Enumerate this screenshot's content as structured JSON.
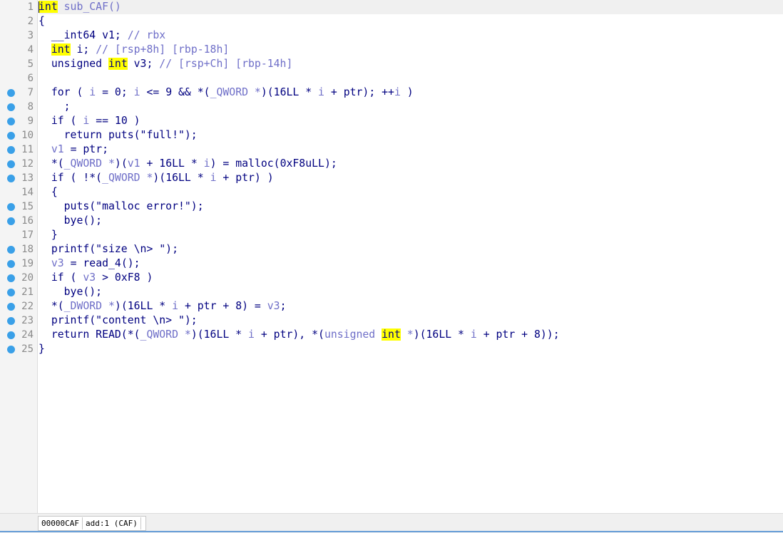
{
  "code_lines": [
    {
      "num": "1",
      "bp": false,
      "tokens": [
        {
          "t": "int",
          "c": "hl"
        },
        {
          "t": " sub_CAF()",
          "c": "var"
        }
      ]
    },
    {
      "num": "2",
      "bp": false,
      "tokens": [
        {
          "t": "{",
          "c": "plain"
        }
      ]
    },
    {
      "num": "3",
      "bp": false,
      "tokens": [
        {
          "t": "  __int64 v1; ",
          "c": "plain"
        },
        {
          "t": "// rbx",
          "c": "comment"
        }
      ]
    },
    {
      "num": "4",
      "bp": false,
      "tokens": [
        {
          "t": "  ",
          "c": "plain"
        },
        {
          "t": "int",
          "c": "hl"
        },
        {
          "t": " i; ",
          "c": "plain"
        },
        {
          "t": "// [rsp+8h] [rbp-18h]",
          "c": "comment"
        }
      ]
    },
    {
      "num": "5",
      "bp": false,
      "tokens": [
        {
          "t": "  unsigned ",
          "c": "plain"
        },
        {
          "t": "int",
          "c": "hl"
        },
        {
          "t": " v3; ",
          "c": "plain"
        },
        {
          "t": "// [rsp+Ch] [rbp-14h]",
          "c": "comment"
        }
      ]
    },
    {
      "num": "6",
      "bp": false,
      "tokens": []
    },
    {
      "num": "7",
      "bp": true,
      "tokens": [
        {
          "t": "  for ( ",
          "c": "plain"
        },
        {
          "t": "i",
          "c": "var"
        },
        {
          "t": " = 0; ",
          "c": "plain"
        },
        {
          "t": "i",
          "c": "var"
        },
        {
          "t": " <= 9 && *(",
          "c": "plain"
        },
        {
          "t": "_QWORD *",
          "c": "var"
        },
        {
          "t": ")(16LL * ",
          "c": "plain"
        },
        {
          "t": "i",
          "c": "var"
        },
        {
          "t": " + ptr); ++",
          "c": "plain"
        },
        {
          "t": "i",
          "c": "var"
        },
        {
          "t": " )",
          "c": "plain"
        }
      ]
    },
    {
      "num": "8",
      "bp": true,
      "tokens": [
        {
          "t": "    ;",
          "c": "plain"
        }
      ]
    },
    {
      "num": "9",
      "bp": true,
      "tokens": [
        {
          "t": "  if ( ",
          "c": "plain"
        },
        {
          "t": "i",
          "c": "var"
        },
        {
          "t": " == 10 )",
          "c": "plain"
        }
      ]
    },
    {
      "num": "10",
      "bp": true,
      "tokens": [
        {
          "t": "    return puts(\"full!\");",
          "c": "plain"
        }
      ]
    },
    {
      "num": "11",
      "bp": true,
      "tokens": [
        {
          "t": "  ",
          "c": "plain"
        },
        {
          "t": "v1",
          "c": "var"
        },
        {
          "t": " = ptr;",
          "c": "plain"
        }
      ]
    },
    {
      "num": "12",
      "bp": true,
      "tokens": [
        {
          "t": "  *(",
          "c": "plain"
        },
        {
          "t": "_QWORD *",
          "c": "var"
        },
        {
          "t": ")(",
          "c": "plain"
        },
        {
          "t": "v1",
          "c": "var"
        },
        {
          "t": " + 16LL * ",
          "c": "plain"
        },
        {
          "t": "i",
          "c": "var"
        },
        {
          "t": ") = malloc(0xF8uLL);",
          "c": "plain"
        }
      ]
    },
    {
      "num": "13",
      "bp": true,
      "tokens": [
        {
          "t": "  if ( !*(",
          "c": "plain"
        },
        {
          "t": "_QWORD *",
          "c": "var"
        },
        {
          "t": ")(16LL * ",
          "c": "plain"
        },
        {
          "t": "i",
          "c": "var"
        },
        {
          "t": " + ptr) )",
          "c": "plain"
        }
      ]
    },
    {
      "num": "14",
      "bp": false,
      "tokens": [
        {
          "t": "  {",
          "c": "plain"
        }
      ]
    },
    {
      "num": "15",
      "bp": true,
      "tokens": [
        {
          "t": "    puts(\"malloc error!\");",
          "c": "plain"
        }
      ]
    },
    {
      "num": "16",
      "bp": true,
      "tokens": [
        {
          "t": "    bye();",
          "c": "plain"
        }
      ]
    },
    {
      "num": "17",
      "bp": false,
      "tokens": [
        {
          "t": "  }",
          "c": "plain"
        }
      ]
    },
    {
      "num": "18",
      "bp": true,
      "tokens": [
        {
          "t": "  printf(\"size \\n> \");",
          "c": "plain"
        }
      ]
    },
    {
      "num": "19",
      "bp": true,
      "tokens": [
        {
          "t": "  ",
          "c": "plain"
        },
        {
          "t": "v3",
          "c": "var"
        },
        {
          "t": " = read_4();",
          "c": "plain"
        }
      ]
    },
    {
      "num": "20",
      "bp": true,
      "tokens": [
        {
          "t": "  if ( ",
          "c": "plain"
        },
        {
          "t": "v3",
          "c": "var"
        },
        {
          "t": " > 0xF8 )",
          "c": "plain"
        }
      ]
    },
    {
      "num": "21",
      "bp": true,
      "tokens": [
        {
          "t": "    bye();",
          "c": "plain"
        }
      ]
    },
    {
      "num": "22",
      "bp": true,
      "tokens": [
        {
          "t": "  *(",
          "c": "plain"
        },
        {
          "t": "_DWORD *",
          "c": "var"
        },
        {
          "t": ")(16LL * ",
          "c": "plain"
        },
        {
          "t": "i",
          "c": "var"
        },
        {
          "t": " + ptr + 8) = ",
          "c": "plain"
        },
        {
          "t": "v3",
          "c": "var"
        },
        {
          "t": ";",
          "c": "plain"
        }
      ]
    },
    {
      "num": "23",
      "bp": true,
      "tokens": [
        {
          "t": "  printf(\"content \\n> \");",
          "c": "plain"
        }
      ]
    },
    {
      "num": "24",
      "bp": true,
      "tokens": [
        {
          "t": "  return READ(*(",
          "c": "plain"
        },
        {
          "t": "_QWORD *",
          "c": "var"
        },
        {
          "t": ")(16LL * ",
          "c": "plain"
        },
        {
          "t": "i",
          "c": "var"
        },
        {
          "t": " + ptr), *(",
          "c": "plain"
        },
        {
          "t": "unsigned ",
          "c": "var"
        },
        {
          "t": "int",
          "c": "hl"
        },
        {
          "t": " *",
          "c": "var"
        },
        {
          "t": ")(16LL * ",
          "c": "plain"
        },
        {
          "t": "i",
          "c": "var"
        },
        {
          "t": " + ptr + 8));",
          "c": "plain"
        }
      ]
    },
    {
      "num": "25",
      "bp": true,
      "tokens": [
        {
          "t": "}",
          "c": "plain"
        }
      ]
    }
  ],
  "status": {
    "address": "00000CAF",
    "location": "add:1 (CAF)",
    "extra": ""
  },
  "colors": {
    "breakpoint": "#3aa0e8",
    "highlight": "#ffff00",
    "code": "#000080",
    "variable": "#6f6fc8"
  }
}
